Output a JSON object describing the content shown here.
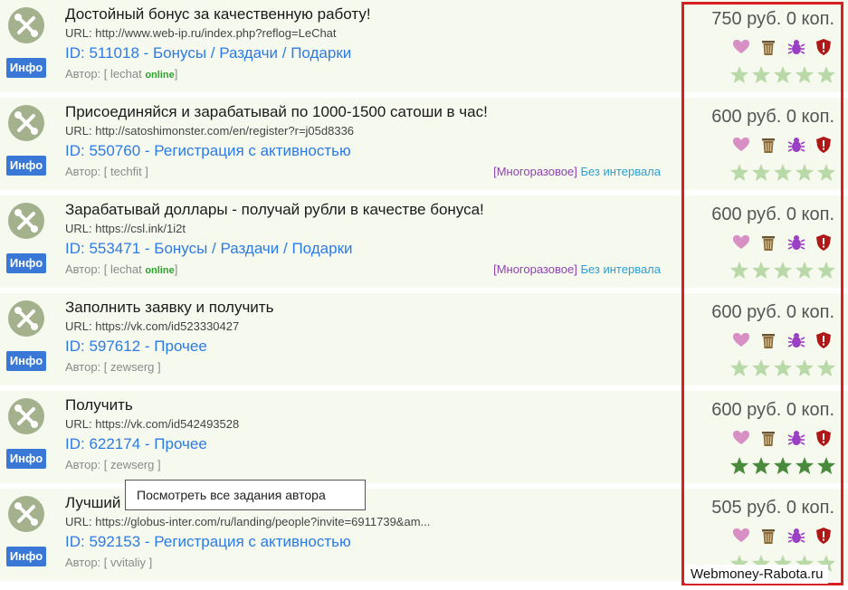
{
  "tasks": [
    {
      "title": "Достойный бонус за качественную работу!",
      "url": "URL: http://www.web-ip.ru/index.php?reflog=LeChat",
      "id_line": "ID: 511018 - Бонусы / Раздачи / Подарки",
      "author": "Автор: [ lechat ",
      "online": "online",
      "author_close": "]",
      "tag_multi": "",
      "tag_interval": "",
      "price": "750 руб. 0 коп.",
      "stars_active": false
    },
    {
      "title": "Присоединяйся и зарабатывай по 1000-1500 сатоши в час!",
      "url": "URL: http://satoshimonster.com/en/register?r=j05d8336",
      "id_line": "ID: 550760 - Регистрация с активностью",
      "author": "Автор: [ techfit ]",
      "online": "",
      "author_close": "",
      "tag_multi": "[Многоразовое]",
      "tag_interval": "Без интервала",
      "price": "600 руб. 0 коп.",
      "stars_active": false
    },
    {
      "title": "Зарабатывай доллары - получай рубли в качестве бонуса!",
      "url": "URL: https://csl.ink/1i2t",
      "id_line": "ID: 553471 - Бонусы / Раздачи / Подарки",
      "author": "Автор: [ lechat ",
      "online": "online",
      "author_close": "]",
      "tag_multi": "[Многоразовое]",
      "tag_interval": "Без интервала",
      "price": "600 руб. 0 коп.",
      "stars_active": false
    },
    {
      "title": "Заполнить заявку и получить",
      "url": "URL: https://vk.com/id523330427",
      "id_line": "ID: 597612 - Прочее",
      "author": "Автор: [ zewserg ]",
      "online": "",
      "author_close": "",
      "tag_multi": "",
      "tag_interval": "",
      "price": "600 руб. 0 коп.",
      "stars_active": false
    },
    {
      "title": "Получить",
      "url": "URL: https://vk.com/id542493528",
      "id_line": "ID: 622174 - Прочее",
      "author": "Автор: [ zewserg ]",
      "online": "",
      "author_close": "",
      "tag_multi": "",
      "tag_interval": "",
      "price": "600 руб. 0 коп.",
      "stars_active": true
    },
    {
      "title": "Лучший                                               ений",
      "url": "URL: https://globus-inter.com/ru/landing/people?invite=6911739&am...",
      "id_line": "ID: 592153 - Регистрация с активностью",
      "author": "Автор: [ vvitaliy ]",
      "online": "",
      "author_close": "",
      "tag_multi": "",
      "tag_interval": "",
      "price": "505 руб. 0 коп.",
      "stars_active": false
    }
  ],
  "info_label": "Инфо",
  "tooltip": "Посмотреть все задания автора",
  "watermark": "Webmoney-Rabota.ru",
  "colors": {
    "accent": "#3a78d8",
    "highlight": "#d92020",
    "star_inactive": "#b9d9a9",
    "star_active": "#4a8a3c",
    "heart": "#d88fc4",
    "trash": "#8b6b3a",
    "bug": "#9b3fc4",
    "shield": "#b01818"
  },
  "icons": [
    "tool-icon",
    "heart-icon",
    "trash-icon",
    "bug-icon",
    "shield-icon",
    "star-icon"
  ]
}
